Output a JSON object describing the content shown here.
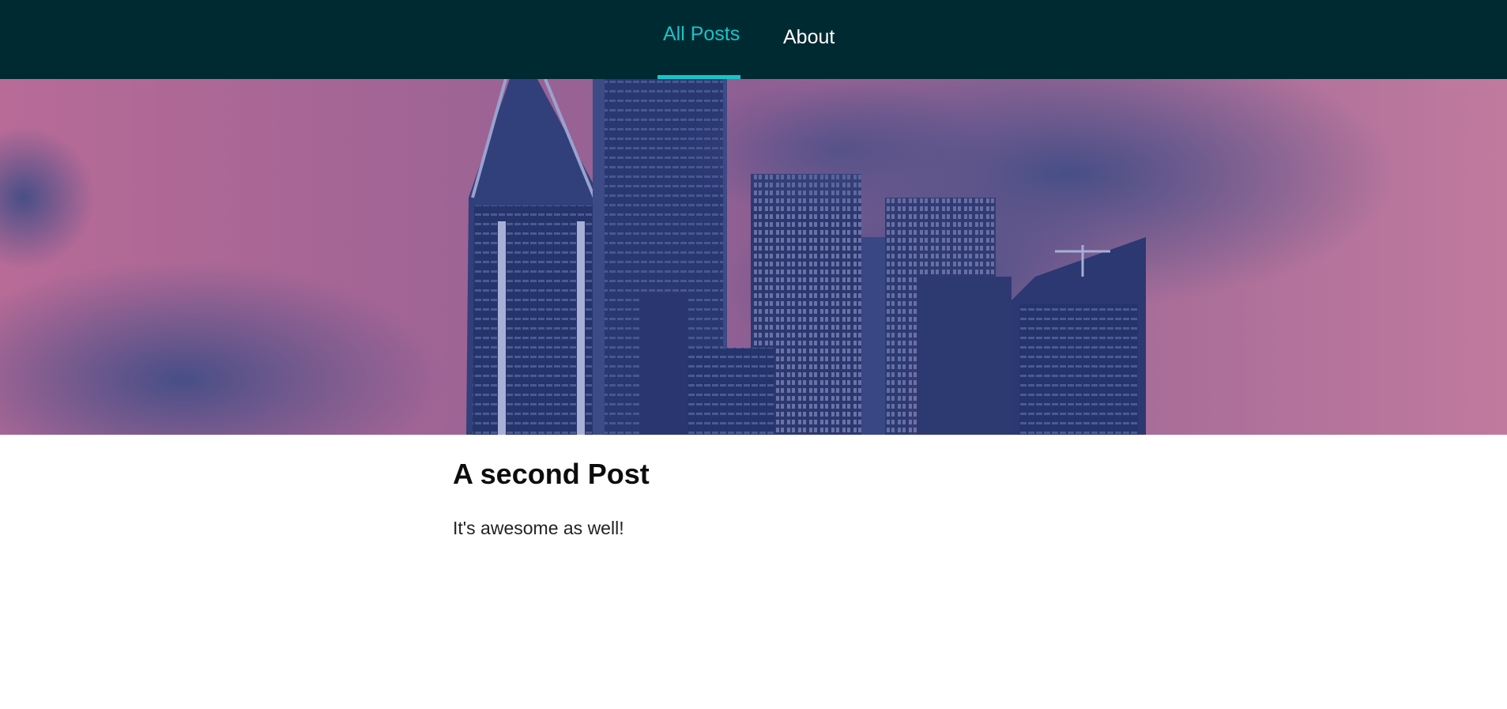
{
  "nav": {
    "items": [
      {
        "label": "All Posts",
        "active": true
      },
      {
        "label": "About",
        "active": false
      }
    ],
    "accent_color": "#19c3c8",
    "background_color": "#002a32"
  },
  "hero": {
    "description_icon": "city-skyline-image",
    "tint_colors": [
      "#b56b96",
      "#303c78"
    ]
  },
  "post": {
    "title": "A second Post",
    "body": "It's awesome as well!"
  }
}
